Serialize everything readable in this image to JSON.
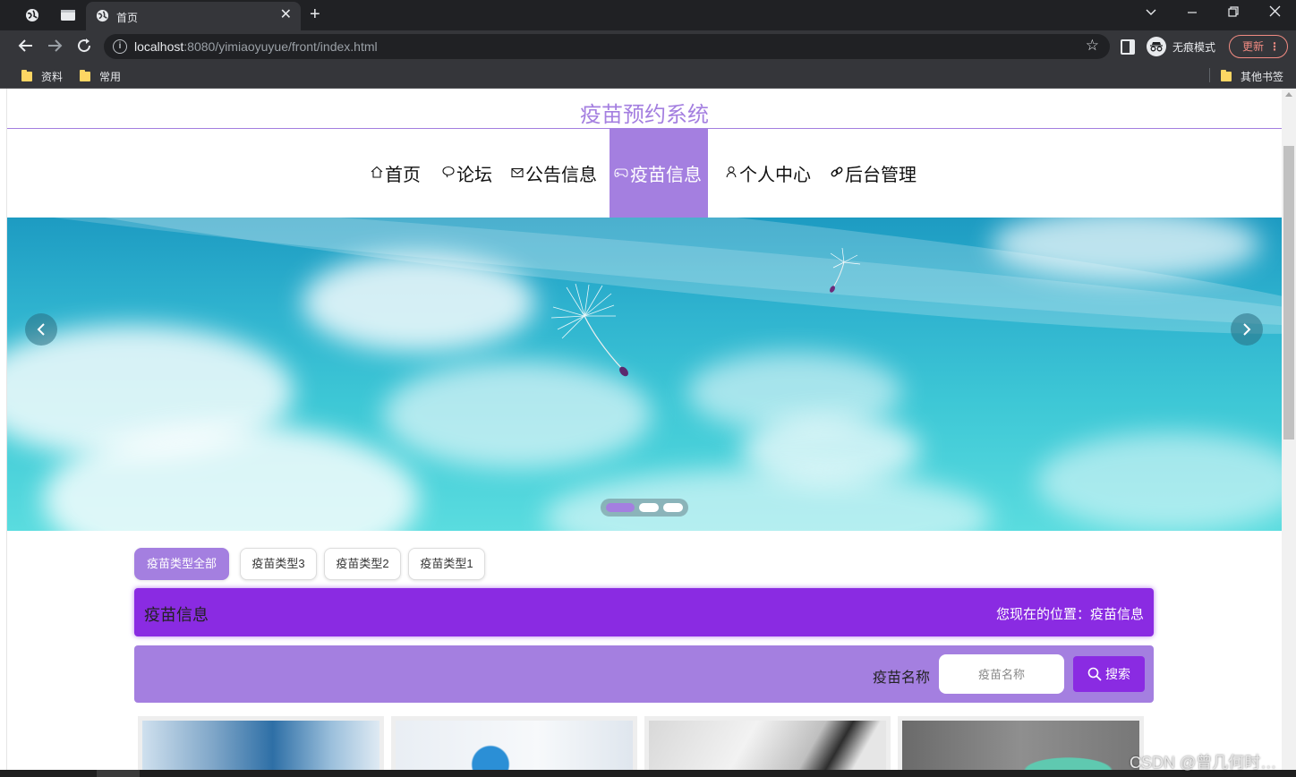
{
  "browser": {
    "tab_title": "首页",
    "tab_close": "✕",
    "new_tab": "+",
    "url_host": "localhost",
    "url_rest": ":8080/yimiaoyuyue/front/index.html",
    "incognito_label": "无痕模式",
    "update_label": "更新",
    "bookmarks": [
      "资料",
      "常用"
    ],
    "other_bookmarks": "其他书签"
  },
  "site": {
    "title": "疫苗预约系统",
    "nav": [
      {
        "label": "首页",
        "icon": "home-icon"
      },
      {
        "label": "论坛",
        "icon": "chat-bubble-icon"
      },
      {
        "label": "公告信息",
        "icon": "mail-icon"
      },
      {
        "label": "疫苗信息",
        "icon": "gamepad-icon",
        "active": true
      },
      {
        "label": "个人中心",
        "icon": "user-icon"
      },
      {
        "label": "后台管理",
        "icon": "link-icon"
      }
    ]
  },
  "banner": {
    "slides": 3,
    "active_slide": 1,
    "prev_icon": "chevron-left-icon",
    "next_icon": "chevron-right-icon"
  },
  "filters": [
    {
      "label": "疫苗类型全部",
      "active": true
    },
    {
      "label": "疫苗类型3",
      "active": false
    },
    {
      "label": "疫苗类型2",
      "active": false
    },
    {
      "label": "疫苗类型1",
      "active": false
    }
  ],
  "section": {
    "title": "疫苗信息",
    "breadcrumb": "您现在的位置：疫苗信息"
  },
  "search": {
    "label": "疫苗名称",
    "placeholder": "疫苗名称",
    "button": "搜索"
  },
  "colors": {
    "accent": "#a47fe0",
    "primary": "#8a2be2"
  },
  "watermark": "CSDN @曾几何时…"
}
